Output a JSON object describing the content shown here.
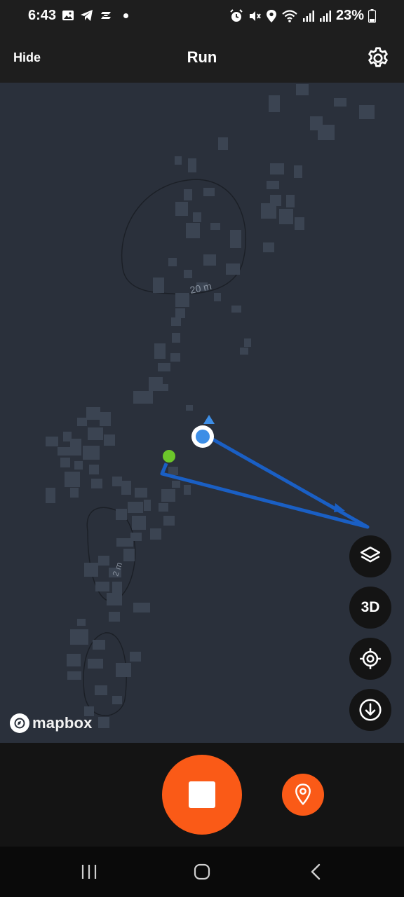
{
  "status_bar": {
    "time": "6:43",
    "left_icons": [
      "gallery-icon",
      "telegram-icon",
      "s-app-icon",
      "dot-icon"
    ],
    "right_icons": [
      "alarm-icon",
      "mute-icon",
      "location-icon",
      "wifi-icon",
      "signal-icon",
      "signal-icon"
    ],
    "battery": "23%"
  },
  "header": {
    "hide_label": "Hide",
    "title": "Run",
    "settings_icon": "gear-icon"
  },
  "map": {
    "contour_labels": [
      "20 m",
      "2 m"
    ],
    "attribution": "mapbox",
    "controls": [
      {
        "name": "layers",
        "icon": "layers-icon"
      },
      {
        "name": "3d",
        "label": "3D"
      },
      {
        "name": "locate",
        "icon": "crosshair-icon"
      },
      {
        "name": "download",
        "icon": "download-icon"
      }
    ],
    "route_color": "#1a5fc4",
    "start_color": "#6cc62a",
    "position_color": "#3d8ee6"
  },
  "bottom": {
    "stop_icon": "stop-icon",
    "marker_icon": "map-pin-icon",
    "accent": "#fa5a17"
  },
  "nav": {
    "recents_icon": "recents-icon",
    "home_icon": "home-icon",
    "back_icon": "back-icon"
  }
}
